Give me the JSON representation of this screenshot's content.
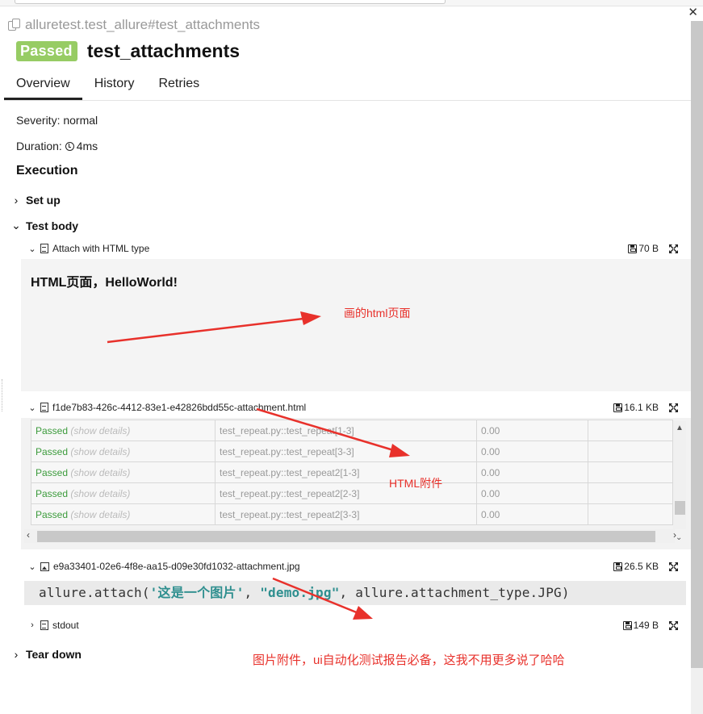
{
  "test": {
    "full_name": "alluretest.test_allure#test_attachments",
    "status": "Passed",
    "title": "test_attachments"
  },
  "tabs": [
    {
      "label": "Overview",
      "active": true
    },
    {
      "label": "History",
      "active": false
    },
    {
      "label": "Retries",
      "active": false
    }
  ],
  "severity": {
    "label": "Severity:",
    "value": "normal"
  },
  "duration": {
    "label": "Duration:",
    "value": "4ms"
  },
  "execution": {
    "title": "Execution",
    "set_up": "Set up",
    "test_body": "Test body",
    "tear_down": "Tear down"
  },
  "attachments": [
    {
      "name": "Attach with HTML type",
      "size": "70 B",
      "icon": "html-file-icon"
    },
    {
      "name": "f1de7b83-426c-4412-83e1-e42826bdd55c-attachment.html",
      "size": "16.1 KB",
      "icon": "html-file-icon"
    },
    {
      "name": "e9a33401-02e6-4f8e-aa15-d09e30fd1032-attachment.jpg",
      "size": "26.5 KB",
      "icon": "image-file-icon"
    },
    {
      "name": "stdout",
      "size": "149 B",
      "icon": "text-file-icon"
    }
  ],
  "html_preview": {
    "heading": "HTML页面，HelloWorld!"
  },
  "table_preview": {
    "rows": [
      {
        "status": "Passed",
        "details": "(show details)",
        "name": "test_repeat.py::test_repeat[1-3]",
        "time": "0.00"
      },
      {
        "status": "Passed",
        "details": "(show details)",
        "name": "test_repeat.py::test_repeat[3-3]",
        "time": "0.00"
      },
      {
        "status": "Passed",
        "details": "(show details)",
        "name": "test_repeat.py::test_repeat2[1-3]",
        "time": "0.00"
      },
      {
        "status": "Passed",
        "details": "(show details)",
        "name": "test_repeat.py::test_repeat2[2-3]",
        "time": "0.00"
      },
      {
        "status": "Passed",
        "details": "(show details)",
        "name": "test_repeat.py::test_repeat2[3-3]",
        "time": "0.00"
      }
    ]
  },
  "code_preview": {
    "prefix": "allure.attach(",
    "arg1": "'这是一个图片'",
    "sep1": ", ",
    "arg2": "\"demo.jpg\"",
    "suffix": ", allure.attachment_type.JPG)"
  },
  "annotations": {
    "html_page": "画的html页面",
    "html_attachment": "HTML附件",
    "image_attachment": "图片附件，ui自动化测试报告必备，这我不用更多说了哈哈"
  },
  "colors": {
    "passed": "#97cc64",
    "annotation": "#e8312b"
  }
}
